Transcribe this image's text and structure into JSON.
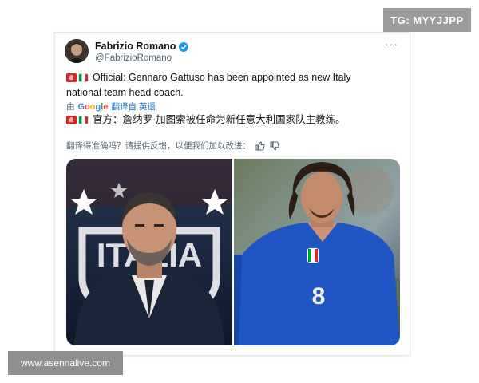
{
  "watermarks": {
    "telegram": "TG: MYYJJPP",
    "site": "www.asennalive.com"
  },
  "tweet": {
    "author_name": "Fabrizio Romano",
    "author_handle": "@FabrizioRomano",
    "verified": true,
    "more_label": "···",
    "text_line1": "Official: Gennaro Gattuso has been appointed as new Italy",
    "text_line2": "national team head coach.",
    "translation": {
      "by_label": "由",
      "google": [
        "G",
        "o",
        "o",
        "g",
        "l",
        "e"
      ],
      "link_label": "翻译自 英语"
    },
    "text_zh": "官方：詹纳罗·加图索被任命为新任意大利国家队主教练。",
    "feedback_prompt": "翻译得准确吗？请提供反馈，以便我们加以改进：",
    "photo_left_text": "ITALIA",
    "jersey_number": "8"
  },
  "colors": {
    "verified_blue": "#1d9bf0",
    "link_blue": "#1d6fc4",
    "italy_blue": "#1f56c4"
  },
  "icons": [
    "verified-badge-icon",
    "more-icon",
    "thumbs-up-icon",
    "thumbs-down-icon",
    "alarm-flag-icon",
    "italy-flag-icon"
  ]
}
